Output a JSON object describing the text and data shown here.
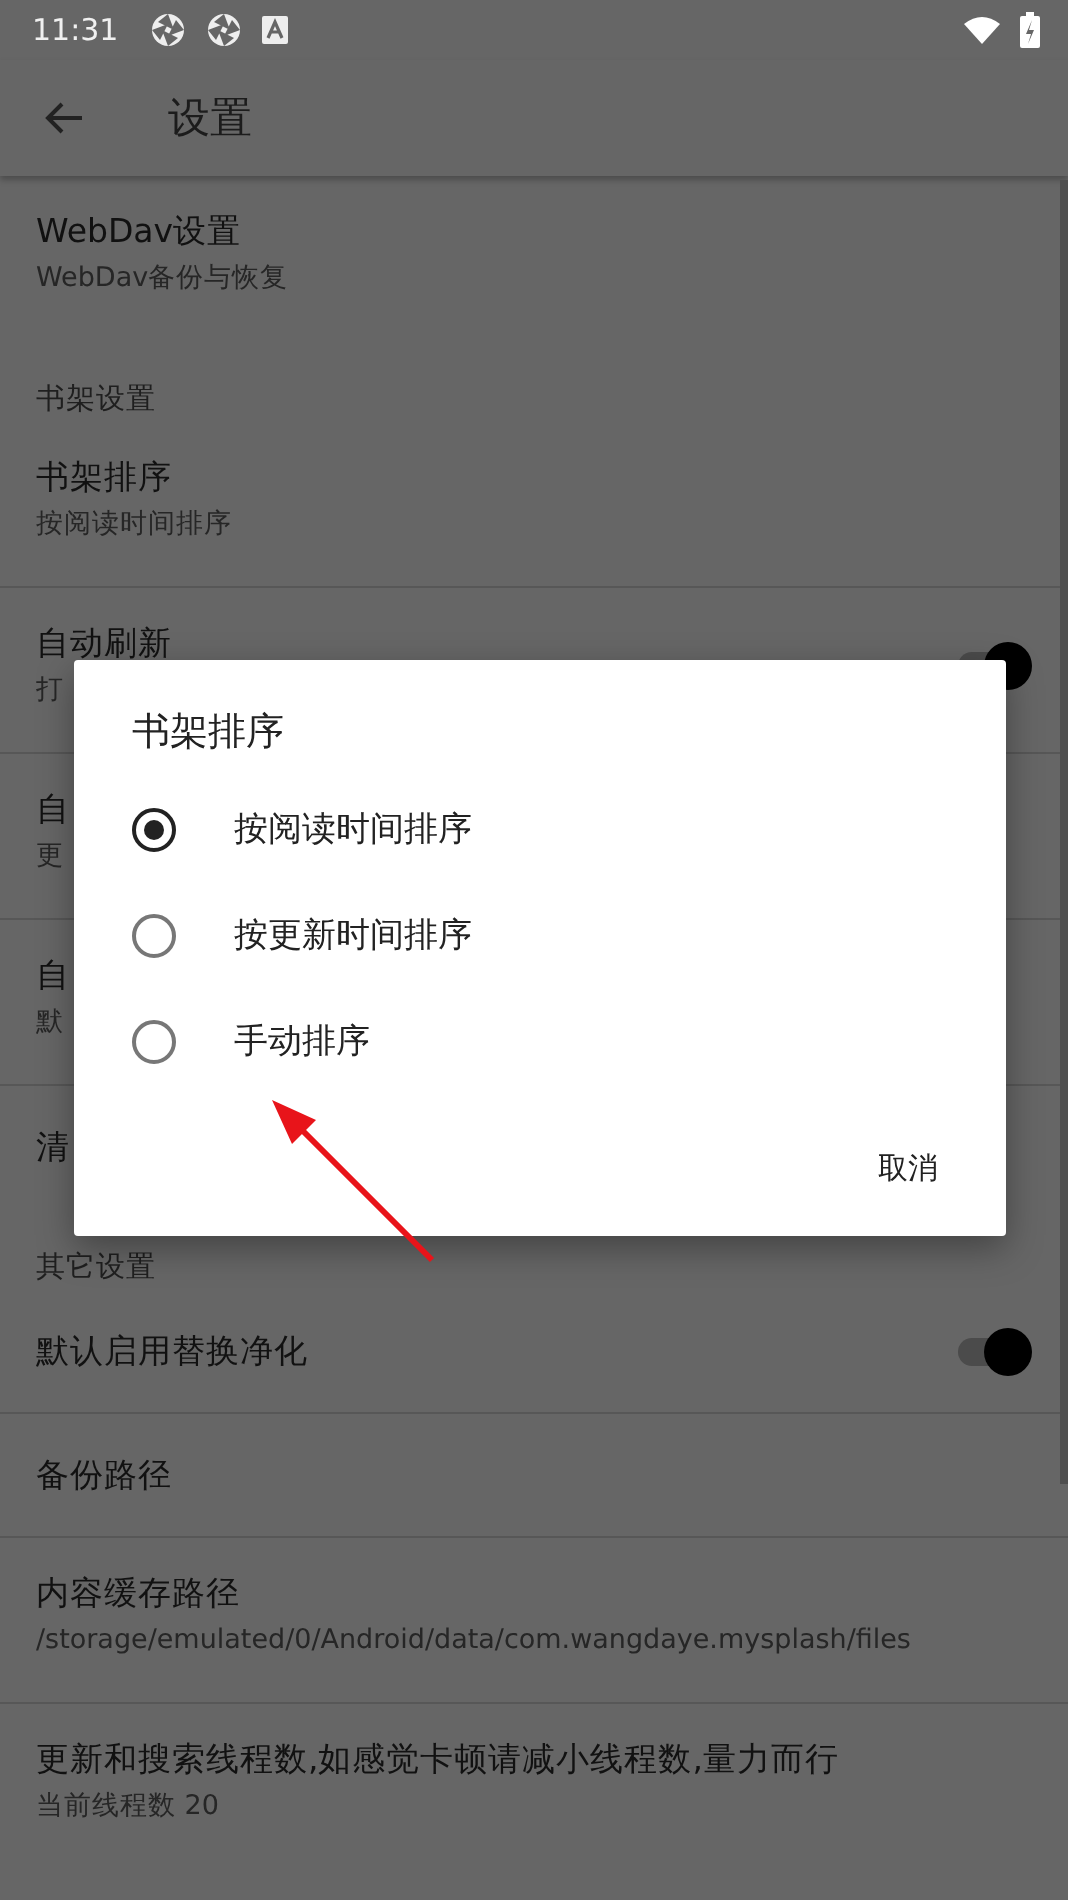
{
  "status_bar": {
    "time": "11:31"
  },
  "toolbar": {
    "title": "设置"
  },
  "groups": [
    {
      "items": [
        {
          "title": "WebDav设置",
          "subtitle": "WebDav备份与恢复"
        }
      ]
    },
    {
      "header": "书架设置",
      "items": [
        {
          "title": "书架排序",
          "subtitle": "按阅读时间排序"
        },
        {
          "title": "自动刷新",
          "subtitle": "打",
          "toggle": {
            "on": true
          }
        },
        {
          "title": "自",
          "subtitle": "更"
        },
        {
          "title": "自",
          "subtitle": "默"
        },
        {
          "title": "清"
        }
      ]
    },
    {
      "header": "其它设置",
      "items": [
        {
          "title": "默认启用替换净化",
          "toggle": {
            "on": true
          }
        },
        {
          "title": "备份路径"
        },
        {
          "title": "内容缓存路径",
          "subtitle": "/storage/emulated/0/Android/data/com.wangdaye.mysplash/files"
        },
        {
          "title": "更新和搜索线程数,如感觉卡顿请减小线程数,量力而行",
          "subtitle": "当前线程数 20"
        }
      ]
    }
  ],
  "dialog": {
    "title": "书架排序",
    "options": [
      {
        "label": "按阅读时间排序",
        "selected": true
      },
      {
        "label": "按更新时间排序",
        "selected": false
      },
      {
        "label": "手动排序",
        "selected": false
      }
    ],
    "buttons": [
      "取消"
    ]
  }
}
